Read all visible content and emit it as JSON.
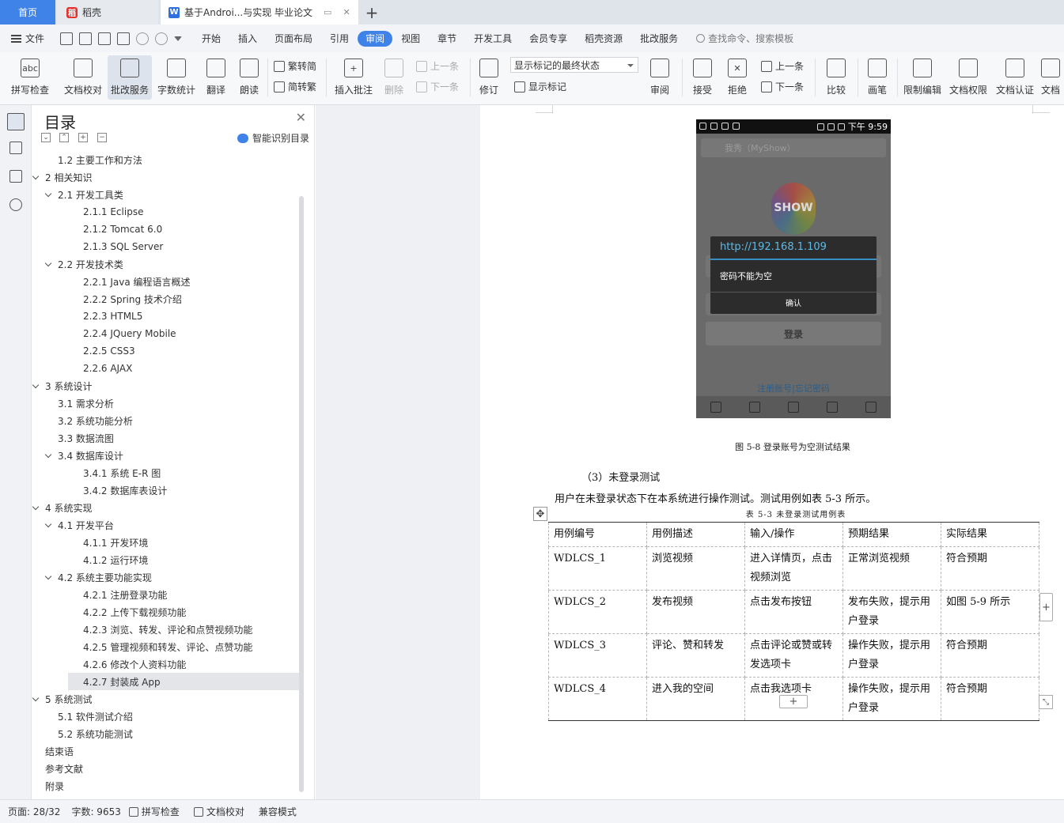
{
  "tabs": {
    "home": "首页",
    "daoke": "稻壳",
    "doc": "基于Androi...与实现 毕业论文"
  },
  "menu": {
    "file": "文件",
    "items": [
      "开始",
      "插入",
      "页面布局",
      "引用",
      "审阅",
      "视图",
      "章节",
      "开发工具",
      "会员专享",
      "稻壳资源",
      "批改服务"
    ],
    "active": "审阅",
    "search": "查找命令、搜索模板"
  },
  "ribbon": {
    "spell": "拼写检查",
    "proof": "文档校对",
    "correct_service": "批改服务",
    "word_count": "字数统计",
    "translate": "翻译",
    "read_aloud": "朗读",
    "to_trad": "繁转简",
    "to_simp": "简转繁",
    "insert_comment": "插入批注",
    "delete": "删除",
    "prev": "上一条",
    "next": "下一条",
    "revise": "修订",
    "markup_state": "显示标记的最终状态",
    "show_markup": "显示标记",
    "review": "审阅",
    "accept": "接受",
    "reject": "拒绝",
    "prev2": "上一条",
    "next2": "下一条",
    "compare": "比较",
    "pen": "画笔",
    "restrict_edit": "限制编辑",
    "doc_rights": "文档权限",
    "doc_auth": "文档认证",
    "doc_cut": "文档"
  },
  "toc": {
    "title": "目录",
    "smart": "智能识别目录",
    "items": [
      {
        "text": "1.2 主要工作和方法",
        "level": 2,
        "chevron": false
      },
      {
        "text": "2  相关知识",
        "level": 1,
        "chevron": true
      },
      {
        "text": "2.1 开发工具类",
        "level": 2,
        "chevron": true
      },
      {
        "text": "2.1.1 Eclipse",
        "level": 3,
        "chevron": false
      },
      {
        "text": "2.1.2 Tomcat 6.0",
        "level": 3,
        "chevron": false
      },
      {
        "text": "2.1.3 SQL Server",
        "level": 3,
        "chevron": false
      },
      {
        "text": "2.2 开发技术类",
        "level": 2,
        "chevron": true
      },
      {
        "text": "2.2.1 Java 编程语言概述",
        "level": 3,
        "chevron": false
      },
      {
        "text": "2.2.2 Spring 技术介绍",
        "level": 3,
        "chevron": false
      },
      {
        "text": "2.2.3 HTML5",
        "level": 3,
        "chevron": false
      },
      {
        "text": "2.2.4 JQuery Mobile",
        "level": 3,
        "chevron": false
      },
      {
        "text": "2.2.5 CSS3",
        "level": 3,
        "chevron": false
      },
      {
        "text": "2.2.6 AJAX",
        "level": 3,
        "chevron": false
      },
      {
        "text": "3  系统设计",
        "level": 1,
        "chevron": true
      },
      {
        "text": "3.1 需求分析",
        "level": 2,
        "chevron": false
      },
      {
        "text": "3.2 系统功能分析",
        "level": 2,
        "chevron": false
      },
      {
        "text": "3.3 数据流图",
        "level": 2,
        "chevron": false
      },
      {
        "text": "3.4 数据库设计",
        "level": 2,
        "chevron": true
      },
      {
        "text": "3.4.1 系统 E-R 图",
        "level": 3,
        "chevron": false
      },
      {
        "text": "3.4.2 数据库表设计",
        "level": 3,
        "chevron": false
      },
      {
        "text": "4  系统实现",
        "level": 1,
        "chevron": true
      },
      {
        "text": "4.1 开发平台",
        "level": 2,
        "chevron": true
      },
      {
        "text": "4.1.1 开发环境",
        "level": 3,
        "chevron": false
      },
      {
        "text": "4.1.2 运行环境",
        "level": 3,
        "chevron": false
      },
      {
        "text": "4.2 系统主要功能实现",
        "level": 2,
        "chevron": true
      },
      {
        "text": "4.2.1 注册登录功能",
        "level": 3,
        "chevron": false
      },
      {
        "text": "4.2.2 上传下载视频功能",
        "level": 3,
        "chevron": false
      },
      {
        "text": "4.2.3 浏览、转发、评论和点赞视频功能",
        "level": 3,
        "chevron": false
      },
      {
        "text": "4.2.5 管理视频和转发、评论、点赞功能",
        "level": 3,
        "chevron": false
      },
      {
        "text": "4.2.6 修改个人资料功能",
        "level": 3,
        "chevron": false
      },
      {
        "text": "4.2.7 封装成 App",
        "level": 3,
        "chevron": false,
        "selected": true
      },
      {
        "text": "5  系统测试",
        "level": 1,
        "chevron": true
      },
      {
        "text": "5.1 软件测试介绍",
        "level": 2,
        "chevron": false
      },
      {
        "text": "5.2 系统功能测试",
        "level": 2,
        "chevron": false
      },
      {
        "text": "结束语",
        "level": 1,
        "chevron": false
      },
      {
        "text": "参考文献",
        "level": 1,
        "chevron": false
      },
      {
        "text": "附录",
        "level": 1,
        "chevron": false
      }
    ]
  },
  "phone": {
    "time": "下午 9:59",
    "url": "我秀（MyShow）",
    "logo": "SHOW",
    "dialog_title": "http://192.168.1.109",
    "dialog_msg": "密码不能为空",
    "dialog_ok": "确认",
    "login": "登录",
    "links": "注册账号|忘记密码"
  },
  "doc": {
    "fig_caption": "图 5-8  登录账号为空测试结果",
    "p1": "（3）未登录测试",
    "p2": "用户在未登录状态下在本系统进行操作测试。测试用例如表 5-3 所示。",
    "tbl_caption": "表 5-3  未登录测试用例表",
    "table": {
      "header": [
        "用例编号",
        "用例描述",
        "输入/操作",
        "预期结果",
        "实际结果"
      ],
      "rows": [
        [
          "WDLCS_1",
          "浏览视频",
          "进入详情页，点击视频浏览",
          "正常浏览视频",
          "符合预期"
        ],
        [
          "WDLCS_2",
          "发布视频",
          "点击发布按钮",
          "发布失败，提示用户登录",
          "如图 5-9 所示"
        ],
        [
          "WDLCS_3",
          "评论、赞和转发",
          "点击评论或赞或转发选项卡",
          "操作失败，提示用户登录",
          "符合预期"
        ],
        [
          "WDLCS_4",
          "进入我的空间",
          "点击我选项卡",
          "操作失败，提示用户登录",
          "符合预期"
        ]
      ]
    }
  },
  "status": {
    "page": "页面: 28/32",
    "words": "字数: 9653",
    "spell": "拼写检查",
    "proof": "文档校对",
    "compat": "兼容模式"
  },
  "colors": {
    "accent": "#3f82e8",
    "daoke": "#e5312f"
  }
}
